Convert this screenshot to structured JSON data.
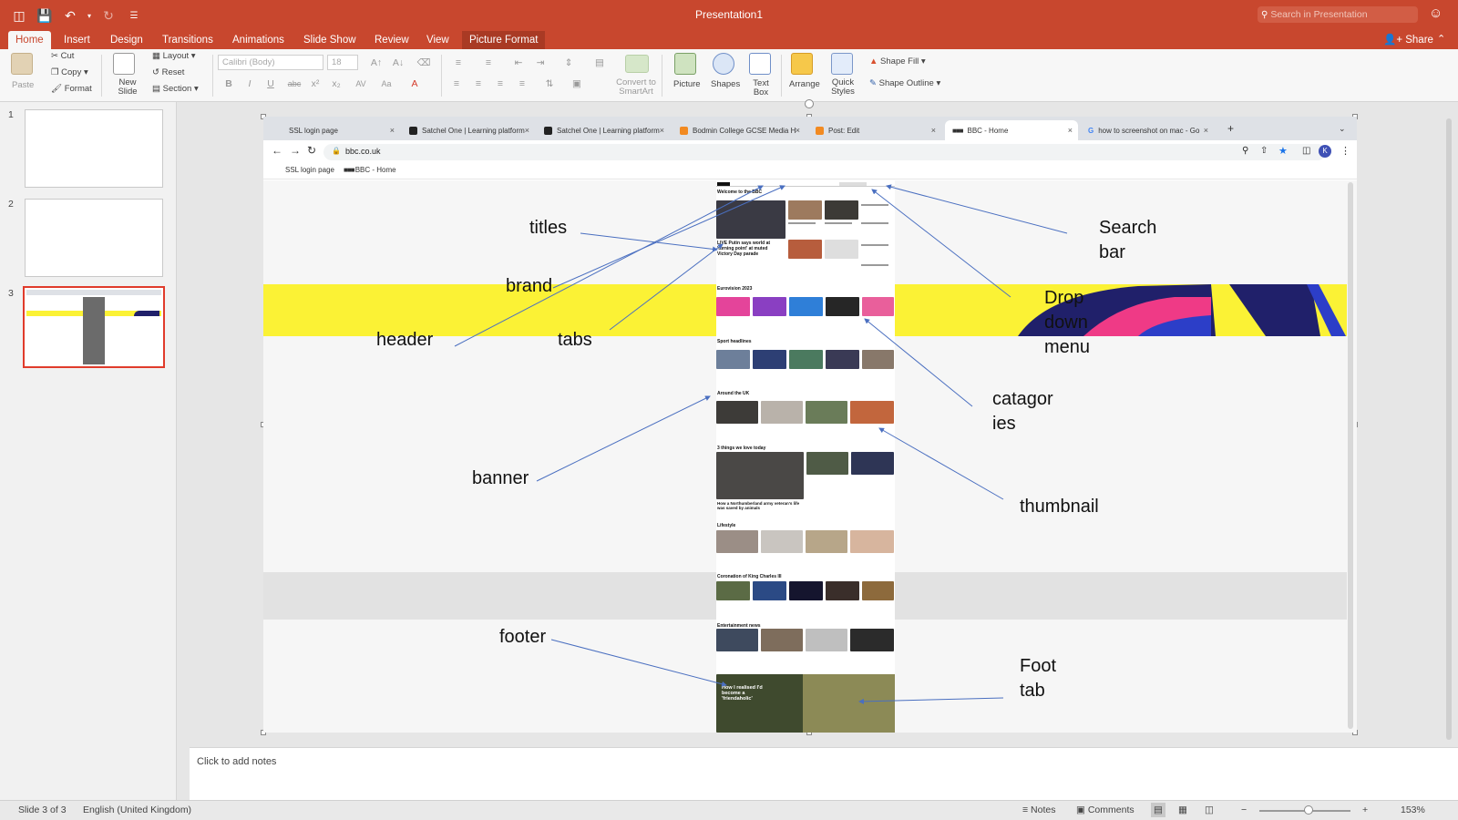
{
  "app": {
    "title": "Presentation1",
    "search_placeholder": "Search in Presentation",
    "share_label": "Share"
  },
  "ribbon_tabs": [
    "Home",
    "Insert",
    "Design",
    "Transitions",
    "Animations",
    "Slide Show",
    "Review",
    "View",
    "Picture Format"
  ],
  "ribbon": {
    "paste": "Paste",
    "cut": "Cut",
    "copy": "Copy",
    "format": "Format",
    "new_slide": "New Slide",
    "layout": "Layout",
    "reset": "Reset",
    "section": "Section",
    "font_name": "Calibri (Body)",
    "font_size": "18",
    "convert_smartart": "Convert to SmartArt",
    "picture": "Picture",
    "shapes": "Shapes",
    "text_box": "Text Box",
    "arrange": "Arrange",
    "quick_styles": "Quick Styles",
    "shape_fill": "Shape Fill",
    "shape_outline": "Shape Outline"
  },
  "thumbnails": [
    "1",
    "2",
    "3"
  ],
  "browser": {
    "tabs": [
      "SSL login page",
      "Satchel One | Learning platform",
      "Satchel One | Learning platform",
      "Bodmin College GCSE Media H",
      "Post: Edit",
      "BBC - Home",
      "how to screenshot on mac - Go"
    ],
    "url": "bbc.co.uk",
    "bookmarks": [
      "SSL login page",
      "BBC - Home"
    ],
    "profile_letter": "K"
  },
  "bbc_page": {
    "welcome": "Welcome to the BBC",
    "headline": "LIVE Putin says world at 'turning point' at muted Victory Day parade",
    "eurovision": "Eurovision 2023",
    "sport": "Sport headlines",
    "around": "Around the UK",
    "things": "3 things we love today",
    "northumberland": "How a Northumberland army veteran's life was saved by animals",
    "lifestyle": "Lifestyle",
    "coronation": "Coronation of King Charles III",
    "entertainment": "Entertainment news",
    "friendaholic": "How I realised I'd become a 'friendaholic'"
  },
  "annotations": {
    "titles": "titles",
    "brand": "brand",
    "header": "header",
    "tabs": "tabs",
    "banner": "banner",
    "footer": "footer",
    "search_bar_1": "Search",
    "search_bar_2": "bar",
    "drop_down_1": "Drop",
    "drop_down_2": "down",
    "drop_down_3": "menu",
    "categories_1": "catagor",
    "categories_2": "ies",
    "thumbnail": "thumbnail",
    "foot_tab_1": "Foot",
    "foot_tab_2": "tab"
  },
  "notes_placeholder": "Click to add notes",
  "status": {
    "slide_info": "Slide 3 of 3",
    "language": "English (United Kingdom)",
    "notes": "Notes",
    "comments": "Comments",
    "zoom": "153%"
  },
  "colors": {
    "accent": "#c8472e",
    "selection": "#e03b2b",
    "banner_yellow": "#fbf235",
    "arrow": "#4a6fc0"
  },
  "icons": [
    "sidebar-icon",
    "save-icon",
    "undo-icon",
    "redo-icon",
    "search-icon",
    "smiley-icon",
    "share-icon"
  ]
}
